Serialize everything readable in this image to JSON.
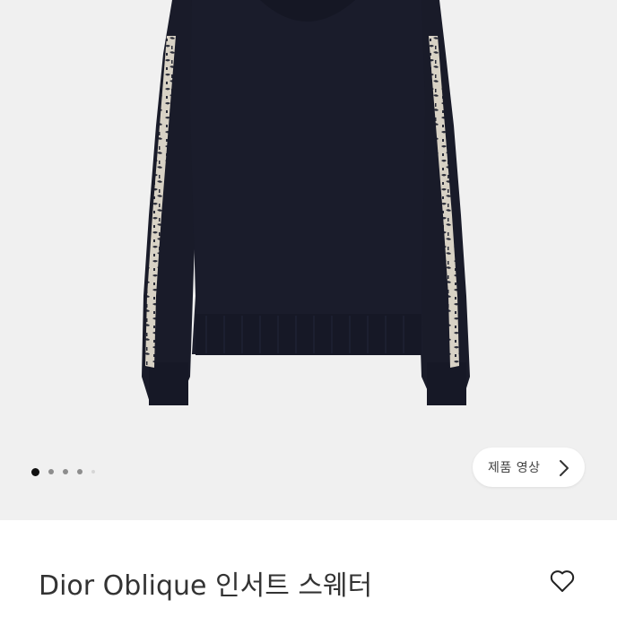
{
  "product": {
    "title": "Dior Oblique 인서트 스웨터",
    "image_description": "navy knit sweater with Oblique jacquard sleeve bands"
  },
  "gallery": {
    "dot_count": 5,
    "active_index": 0
  },
  "video_button": {
    "label": "제품 영상",
    "icon": "chevron-right-icon"
  },
  "wishlist": {
    "icon": "heart-outline-icon"
  },
  "colors": {
    "background": "#f0f0f0",
    "garment": "#191b29",
    "band": "#d8d2c5"
  }
}
